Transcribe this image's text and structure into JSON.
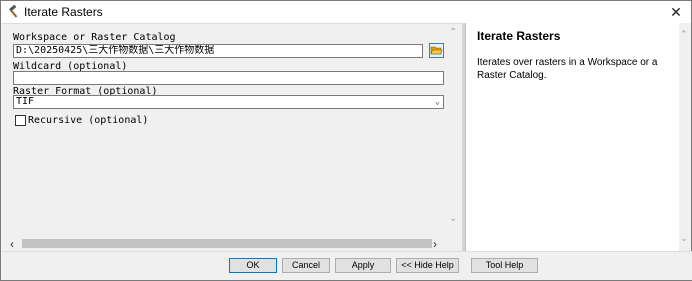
{
  "window": {
    "title": "Iterate Rasters",
    "title_icon": "hammer-icon",
    "close_glyph": "✕"
  },
  "form": {
    "workspace_label": "Workspace or Raster Catalog",
    "workspace_value": "D:\\20250425\\三大作物数据\\三大作物数据",
    "browse_icon": "folder-open-icon",
    "wildcard_label": "Wildcard (optional)",
    "wildcard_value": "",
    "raster_format_label": "Raster Format (optional)",
    "raster_format_value": "TIF",
    "recursive_label": "Recursive (optional)",
    "recursive_checked": false
  },
  "help": {
    "title": "Iterate Rasters",
    "body": "Iterates over rasters in a Workspace or a Raster Catalog."
  },
  "buttons": {
    "ok": "OK",
    "cancel": "Cancel",
    "apply": "Apply",
    "hide_help": "<< Hide Help",
    "tool_help": "Tool Help"
  },
  "colors": {
    "accent": "#0078d7",
    "folder": "#e0a000"
  }
}
